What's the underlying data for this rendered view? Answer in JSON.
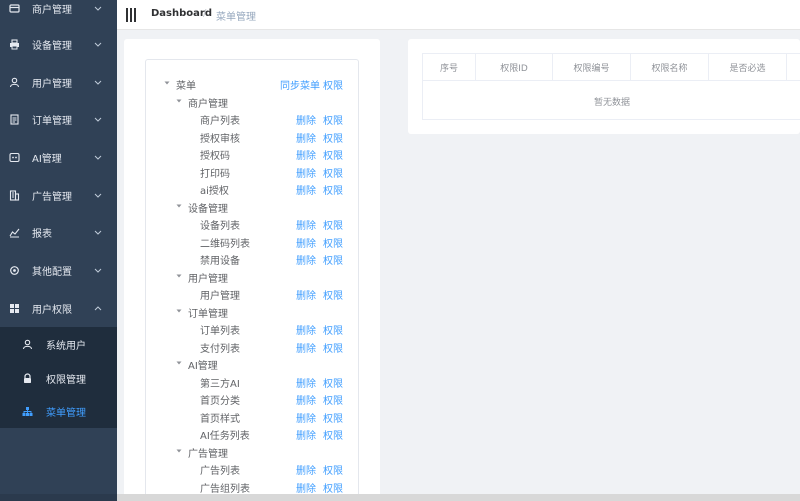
{
  "sidebar": {
    "items": [
      {
        "label": "商户管理",
        "icon": "wallet-icon"
      },
      {
        "label": "设备管理",
        "icon": "printer-icon"
      },
      {
        "label": "用户管理",
        "icon": "user-icon"
      },
      {
        "label": "订单管理",
        "icon": "document-icon"
      },
      {
        "label": "AI管理",
        "icon": "ai-icon"
      },
      {
        "label": "广告管理",
        "icon": "building-icon"
      },
      {
        "label": "报表",
        "icon": "chart-icon"
      },
      {
        "label": "其他配置",
        "icon": "settings-icon"
      },
      {
        "label": "用户权限",
        "icon": "grid-icon"
      }
    ],
    "submenu": [
      {
        "label": "系统用户",
        "icon": "user-icon",
        "active": false
      },
      {
        "label": "权限管理",
        "icon": "lock-icon",
        "active": false
      },
      {
        "label": "菜单管理",
        "icon": "sitemap-icon",
        "active": true
      }
    ]
  },
  "header": {
    "breadcrumb_home": "Dashboard",
    "breadcrumb_sep": "/",
    "breadcrumb_current": "菜单管理"
  },
  "tree": {
    "root": {
      "label": "菜单",
      "sync_label": "同步菜单",
      "perm_label": "权限"
    },
    "action_delete": "删除",
    "action_perm": "权限",
    "groups": [
      {
        "label": "商户管理",
        "children": [
          "商户列表",
          "授权审核",
          "授权码",
          "打印码",
          "ai授权"
        ]
      },
      {
        "label": "设备管理",
        "children": [
          "设备列表",
          "二维码列表",
          "禁用设备"
        ]
      },
      {
        "label": "用户管理",
        "children": [
          "用户管理"
        ]
      },
      {
        "label": "订单管理",
        "children": [
          "订单列表",
          "支付列表"
        ]
      },
      {
        "label": "AI管理",
        "children": [
          "第三方AI",
          "首页分类",
          "首页样式",
          "AI任务列表"
        ]
      },
      {
        "label": "广告管理",
        "children": [
          "广告列表",
          "广告组列表"
        ]
      }
    ]
  },
  "table": {
    "columns": [
      "序号",
      "权限ID",
      "权限编号",
      "权限名称",
      "是否必选"
    ],
    "empty_text": "暂无数据"
  },
  "colors": {
    "sidebar_bg": "#304156",
    "submenu_bg": "#1f2d3d",
    "accent": "#409eff"
  }
}
